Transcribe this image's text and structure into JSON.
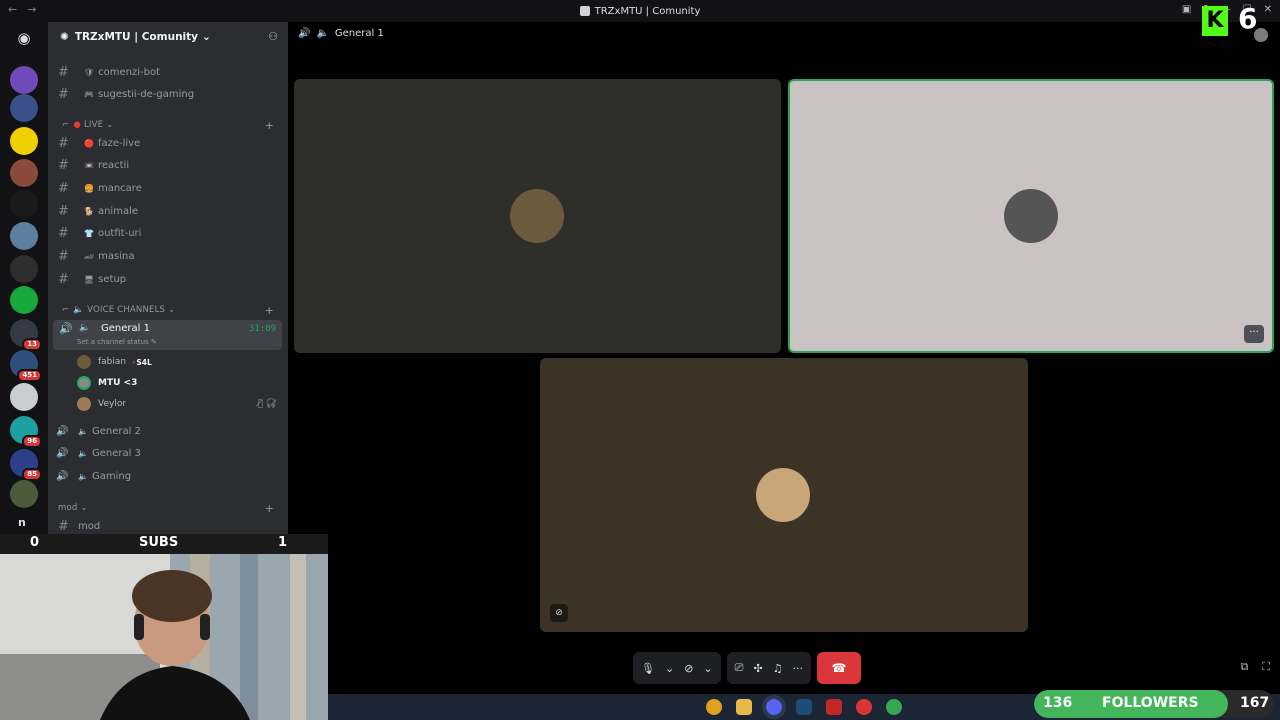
{
  "window": {
    "title": "TRZxMTU | Comunity"
  },
  "server": {
    "name": "TRZxMTU | Comunity"
  },
  "rail": {
    "home_icon": "discord-logo-icon",
    "servers": [
      {
        "color": "#6e4bb8",
        "badge": ""
      },
      {
        "color": "#3b4f8a",
        "badge": ""
      },
      {
        "color": "#f0d000",
        "badge": ""
      },
      {
        "color": "#8a4a3a",
        "badge": ""
      },
      {
        "color": "#1a1a1a",
        "badge": ""
      },
      {
        "color": "#5f7fa0",
        "badge": ""
      },
      {
        "color": "#2e2e2e",
        "badge": ""
      },
      {
        "color": "#18a83b",
        "badge": ""
      },
      {
        "color": "#333a44",
        "badge": "13"
      },
      {
        "color": "#2d4f7a",
        "badge": "451"
      },
      {
        "color": "#c9cfcf",
        "badge": ""
      },
      {
        "color": "#1fa0a0",
        "badge": "96"
      },
      {
        "color": "#2b3f8a",
        "badge": "85"
      },
      {
        "color": "#4a5a3a",
        "badge": ""
      }
    ],
    "bottom_letter": "n"
  },
  "channels_top": [
    {
      "name": "comenzi-bot",
      "emoji": "🛡"
    },
    {
      "name": "sugestii-de-gaming",
      "emoji": "🎮"
    }
  ],
  "live_category": "LIVE",
  "live_channels": [
    {
      "name": "faze-live",
      "emoji": "🔴"
    },
    {
      "name": "reactii",
      "emoji": "📼"
    },
    {
      "name": "mancare",
      "emoji": "🍔"
    },
    {
      "name": "animale",
      "emoji": "🐕"
    },
    {
      "name": "outfit-uri",
      "emoji": "👕"
    },
    {
      "name": "masina",
      "emoji": "🏎"
    },
    {
      "name": "setup",
      "emoji": "🖥"
    }
  ],
  "voice_category": "VOICE CHANNELS",
  "active_voice": {
    "name": "General 1",
    "time": "31:09",
    "status_hint": "Set a channel status"
  },
  "members": [
    {
      "name": "fabian",
      "tag": "S4L",
      "color": "#6b5a3c"
    },
    {
      "name": "MTU <3",
      "tag": "",
      "color": "#8a8a8a"
    },
    {
      "name": "Veylor",
      "tag": "",
      "color": "#9c7a52"
    }
  ],
  "voice_channels": [
    {
      "name": "General 2"
    },
    {
      "name": "General 3"
    },
    {
      "name": "Gaming"
    }
  ],
  "mod_category": "mod",
  "mod_channel": "mod",
  "call": {
    "channel": "General 1",
    "tiles": [
      {
        "bg": "#2e2e2a",
        "avatar_color": "#6b5a3c"
      },
      {
        "bg": "#cbc3c3",
        "avatar_color": "#555"
      },
      {
        "bg": "#3c3226",
        "avatar_color": "#c9a57a"
      }
    ]
  },
  "overlay": {
    "kick_logo": "K",
    "kick_count": "6",
    "subs_label": "SUBS",
    "subs_current": "0",
    "subs_goal": "1",
    "followers_label": "FOLLOWERS",
    "followers_current": "136",
    "followers_goal": "167",
    "followers_progress": 0.81
  }
}
